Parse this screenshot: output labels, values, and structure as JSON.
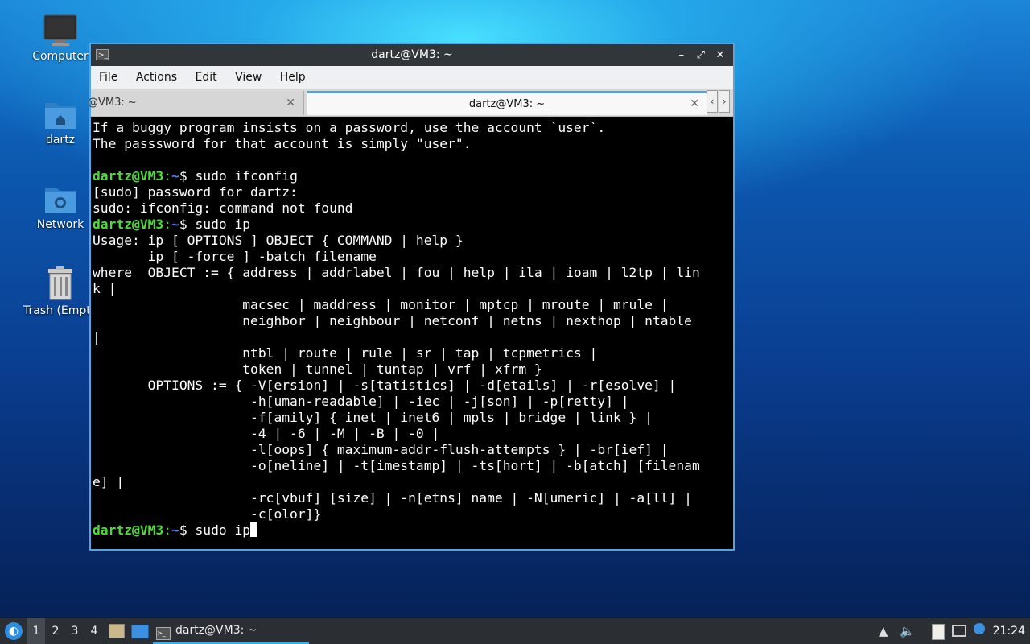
{
  "desktop": {
    "icons": [
      {
        "label": "Computer",
        "icon": "computer-icon"
      },
      {
        "label": "dartz",
        "icon": "home-folder-icon"
      },
      {
        "label": "Network",
        "icon": "network-folder-icon"
      },
      {
        "label": "Trash (Empty)",
        "icon": "trash-icon"
      }
    ]
  },
  "window": {
    "title": "dartz@VM3: ~",
    "controls": {
      "minimize": "–",
      "maximize": "⤢",
      "close": "✕"
    },
    "menu": [
      "File",
      "Actions",
      "Edit",
      "View",
      "Help"
    ],
    "tabs": [
      {
        "label": "@VM3: ~",
        "active": false
      },
      {
        "label": "dartz@VM3: ~",
        "active": true
      }
    ],
    "tab_close": "✕",
    "tab_scroll_left": "‹",
    "tab_scroll_right": "›"
  },
  "terminal": {
    "prompt_user": "dartz@VM3",
    "prompt_sep": ":",
    "prompt_dir": "~",
    "prompt_end": "$ ",
    "lines": [
      {
        "text": "If a buggy program insists on a password, use the account `user`."
      },
      {
        "text": "The passsword for that account is simply \"user\"."
      },
      {
        "text": ""
      },
      {
        "prompt": true,
        "text": "sudo ifconfig"
      },
      {
        "text": "[sudo] password for dartz:"
      },
      {
        "text": "sudo: ifconfig: command not found"
      },
      {
        "prompt": true,
        "text": "sudo ip"
      },
      {
        "text": "Usage: ip [ OPTIONS ] OBJECT { COMMAND | help }"
      },
      {
        "text": "       ip [ -force ] -batch filename"
      },
      {
        "text": "where  OBJECT := { address | addrlabel | fou | help | ila | ioam | l2tp | lin"
      },
      {
        "text": "k |"
      },
      {
        "text": "                   macsec | maddress | monitor | mptcp | mroute | mrule |"
      },
      {
        "text": "                   neighbor | neighbour | netconf | netns | nexthop | ntable"
      },
      {
        "text": "|"
      },
      {
        "text": "                   ntbl | route | rule | sr | tap | tcpmetrics |"
      },
      {
        "text": "                   token | tunnel | tuntap | vrf | xfrm }"
      },
      {
        "text": "       OPTIONS := { -V[ersion] | -s[tatistics] | -d[etails] | -r[esolve] |"
      },
      {
        "text": "                    -h[uman-readable] | -iec | -j[son] | -p[retty] |"
      },
      {
        "text": "                    -f[amily] { inet | inet6 | mpls | bridge | link } |"
      },
      {
        "text": "                    -4 | -6 | -M | -B | -0 |"
      },
      {
        "text": "                    -l[oops] { maximum-addr-flush-attempts } | -br[ief] |"
      },
      {
        "text": "                    -o[neline] | -t[imestamp] | -ts[hort] | -b[atch] [filenam"
      },
      {
        "text": "e] |"
      },
      {
        "text": "                    -rc[vbuf] [size] | -n[etns] name | -N[umeric] | -a[ll] |"
      },
      {
        "text": "                    -c[olor]}"
      },
      {
        "prompt": true,
        "text": "sudo ip",
        "cursor": true
      }
    ]
  },
  "taskbar": {
    "start_icon": "lxqt-start-icon",
    "workspaces": [
      "1",
      "2",
      "3",
      "4"
    ],
    "active_workspace": "1",
    "task_label": "dartz@VM3: ~",
    "clock": "21:24"
  },
  "colors": {
    "prompt_green": "#4ddc36",
    "prompt_blue": "#4b7bff",
    "accent": "#3daee9"
  }
}
